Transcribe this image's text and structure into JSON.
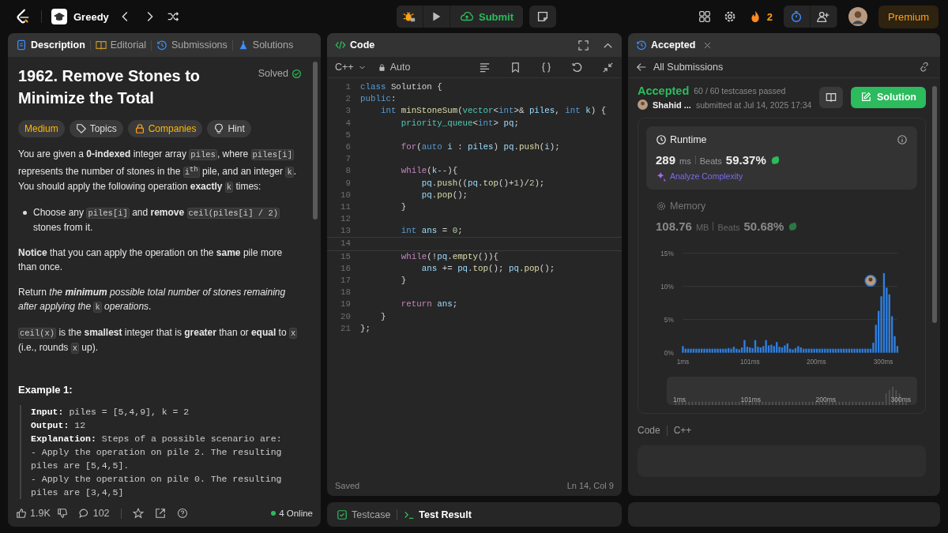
{
  "topbar": {
    "list_name": "Greedy",
    "submit": "Submit",
    "streak": "2",
    "premium": "Premium"
  },
  "left_panel": {
    "tabs": [
      {
        "label": "Description",
        "kind": "description",
        "selected": true
      },
      {
        "label": "Editorial",
        "kind": "editorial",
        "selected": false
      },
      {
        "label": "Submissions",
        "kind": "submissions",
        "selected": false
      },
      {
        "label": "Solutions",
        "kind": "solutions",
        "selected": false
      }
    ],
    "title": "1962. Remove Stones to Minimize the Total",
    "status": "Solved",
    "solved": true,
    "tags": [
      {
        "label": "Medium",
        "kind": "difficulty"
      },
      {
        "label": "Topics",
        "kind": "topics"
      },
      {
        "label": "Companies",
        "kind": "companies"
      },
      {
        "label": "Hint",
        "kind": "hint"
      }
    ],
    "paragraphs": [
      {
        "kind": "text",
        "segments": [
          {
            "kind": "text",
            "t": "You are given a **0-indexed** integer array "
          },
          {
            "kind": "code",
            "t": "piles"
          },
          {
            "kind": "text",
            "t": ", where "
          },
          {
            "kind": "code",
            "t": "piles[i]"
          },
          {
            "kind": "text",
            "t": " represents the number of stones in the "
          },
          {
            "kind": "code",
            "t": "i$^{th}$"
          },
          {
            "kind": "text",
            "t": " pile, and an integer "
          },
          {
            "kind": "code",
            "t": "k"
          },
          {
            "kind": "text",
            "t": ". You should apply the following operation **exactly** "
          },
          {
            "kind": "code",
            "t": "k"
          },
          {
            "kind": "text",
            "t": " times:"
          }
        ]
      },
      {
        "kind": "bullet",
        "segments": [
          {
            "kind": "text",
            "t": "Choose any "
          },
          {
            "kind": "code",
            "t": "piles[i]"
          },
          {
            "kind": "text",
            "t": " and **remove** "
          },
          {
            "kind": "code",
            "t": "ceil(piles[i] / 2)"
          },
          {
            "kind": "text",
            "t": " stones from it."
          }
        ]
      },
      {
        "kind": "text",
        "segments": [
          {
            "kind": "text",
            "t": "**Notice** that you can apply the operation on the **same** pile more than once."
          }
        ]
      },
      {
        "kind": "text",
        "segments": [
          {
            "kind": "text",
            "t": "Return "
          },
          {
            "kind": "em",
            "t": "the **minimum** possible total number of stones remaining after applying the "
          },
          {
            "kind": "code",
            "t": "k"
          },
          {
            "kind": "em",
            "t": " operations"
          },
          {
            "kind": "text",
            "t": "."
          }
        ]
      },
      {
        "kind": "text",
        "segments": [
          {
            "kind": "code",
            "t": "ceil(x)"
          },
          {
            "kind": "text",
            "t": " is the **smallest** integer that is **greater** than or **equal** to "
          },
          {
            "kind": "code",
            "t": "x"
          },
          {
            "kind": "text",
            "t": " (i.e., rounds "
          },
          {
            "kind": "code",
            "t": "x"
          },
          {
            "kind": "text",
            "t": " up)."
          }
        ]
      }
    ],
    "example_title": "Example 1:",
    "example_lines": [
      {
        "label": "Input:",
        "text": "piles = [5,4,9], k = 2"
      },
      {
        "label": "Output:",
        "text": "12"
      },
      {
        "label": "Explanation:",
        "text": "Steps of a possible scenario are:"
      },
      {
        "text": "- Apply the operation on pile 2. The resulting piles are [5,4,5]."
      },
      {
        "text": "- Apply the operation on pile 0. The resulting piles are [3,4,5]"
      }
    ],
    "footer": {
      "likes": "1.9K",
      "comments": "102",
      "online": "4 Online"
    }
  },
  "code_panel": {
    "title": "Code",
    "language": "C++",
    "mode": "Auto",
    "saved": "Saved",
    "cursor": "Ln 14, Col 9",
    "lines": [
      {
        "n": "1",
        "tokens": [
          {
            "kind": "kw",
            "t": "class"
          },
          {
            "kind": "p",
            "t": " Solution {"
          }
        ]
      },
      {
        "n": "2",
        "tokens": [
          {
            "kind": "kw",
            "t": "public"
          },
          {
            "kind": "p",
            "t": ":"
          }
        ]
      },
      {
        "n": "3",
        "tokens": [
          {
            "kind": "kw",
            "t": "    int"
          },
          {
            "kind": "fn",
            "t": " minStoneSum"
          },
          {
            "kind": "p",
            "t": "("
          },
          {
            "kind": "ty",
            "t": "vector"
          },
          {
            "kind": "p",
            "t": "<"
          },
          {
            "kind": "kw",
            "t": "int"
          },
          {
            "kind": "p",
            "t": ">& "
          },
          {
            "kind": "v",
            "t": "piles"
          },
          {
            "kind": "p",
            "t": ", "
          },
          {
            "kind": "kw",
            "t": "int"
          },
          {
            "kind": "v",
            "t": " k"
          },
          {
            "kind": "p",
            "t": ") {"
          }
        ]
      },
      {
        "n": "4",
        "tokens": [
          {
            "kind": "ty",
            "t": "        priority_queue"
          },
          {
            "kind": "p",
            "t": "<"
          },
          {
            "kind": "kw",
            "t": "int"
          },
          {
            "kind": "p",
            "t": "> "
          },
          {
            "kind": "v",
            "t": "pq"
          },
          {
            "kind": "p",
            "t": ";"
          }
        ]
      },
      {
        "n": "5"
      },
      {
        "n": "6",
        "tokens": [
          {
            "kind": "ctl",
            "t": "        for"
          },
          {
            "kind": "p",
            "t": "("
          },
          {
            "kind": "kw",
            "t": "auto"
          },
          {
            "kind": "v",
            "t": " i"
          },
          {
            "kind": "p",
            "t": " : "
          },
          {
            "kind": "v",
            "t": "piles"
          },
          {
            "kind": "p",
            "t": ") "
          },
          {
            "kind": "v",
            "t": "pq"
          },
          {
            "kind": "p",
            "t": "."
          },
          {
            "kind": "fn",
            "t": "push"
          },
          {
            "kind": "p",
            "t": "("
          },
          {
            "kind": "v",
            "t": "i"
          },
          {
            "kind": "p",
            "t": ");"
          }
        ]
      },
      {
        "n": "7"
      },
      {
        "n": "8",
        "tokens": [
          {
            "kind": "ctl",
            "t": "        while"
          },
          {
            "kind": "p",
            "t": "("
          },
          {
            "kind": "v",
            "t": "k"
          },
          {
            "kind": "p",
            "t": "--){"
          }
        ]
      },
      {
        "n": "9",
        "tokens": [
          {
            "kind": "v",
            "t": "            pq"
          },
          {
            "kind": "p",
            "t": "."
          },
          {
            "kind": "fn",
            "t": "push"
          },
          {
            "kind": "p",
            "t": "(("
          },
          {
            "kind": "v",
            "t": "pq"
          },
          {
            "kind": "p",
            "t": "."
          },
          {
            "kind": "fn",
            "t": "top"
          },
          {
            "kind": "p",
            "t": "()+"
          },
          {
            "kind": "num",
            "t": "1"
          },
          {
            "kind": "p",
            "t": ")/"
          },
          {
            "kind": "num",
            "t": "2"
          },
          {
            "kind": "p",
            "t": ");"
          }
        ]
      },
      {
        "n": "10",
        "tokens": [
          {
            "kind": "v",
            "t": "            pq"
          },
          {
            "kind": "p",
            "t": "."
          },
          {
            "kind": "fn",
            "t": "pop"
          },
          {
            "kind": "p",
            "t": "();"
          }
        ]
      },
      {
        "n": "11",
        "tokens": [
          {
            "kind": "p",
            "t": "        }"
          }
        ]
      },
      {
        "n": "12"
      },
      {
        "n": "13",
        "tokens": [
          {
            "kind": "kw",
            "t": "        int"
          },
          {
            "kind": "v",
            "t": " ans"
          },
          {
            "kind": "p",
            "t": " = "
          },
          {
            "kind": "num",
            "t": "0"
          },
          {
            "kind": "p",
            "t": ";"
          }
        ]
      },
      {
        "n": "14",
        "current": true
      },
      {
        "n": "15",
        "tokens": [
          {
            "kind": "ctl",
            "t": "        while"
          },
          {
            "kind": "p",
            "t": "(!"
          },
          {
            "kind": "v",
            "t": "pq"
          },
          {
            "kind": "p",
            "t": "."
          },
          {
            "kind": "fn",
            "t": "empty"
          },
          {
            "kind": "p",
            "t": "()){"
          }
        ]
      },
      {
        "n": "16",
        "tokens": [
          {
            "kind": "v",
            "t": "            ans"
          },
          {
            "kind": "p",
            "t": " += "
          },
          {
            "kind": "v",
            "t": "pq"
          },
          {
            "kind": "p",
            "t": "."
          },
          {
            "kind": "fn",
            "t": "top"
          },
          {
            "kind": "p",
            "t": "(); "
          },
          {
            "kind": "v",
            "t": "pq"
          },
          {
            "kind": "p",
            "t": "."
          },
          {
            "kind": "fn",
            "t": "pop"
          },
          {
            "kind": "p",
            "t": "();"
          }
        ]
      },
      {
        "n": "17",
        "tokens": [
          {
            "kind": "p",
            "t": "        }"
          }
        ]
      },
      {
        "n": "18"
      },
      {
        "n": "19",
        "tokens": [
          {
            "kind": "ctl",
            "t": "        return"
          },
          {
            "kind": "v",
            "t": " ans"
          },
          {
            "kind": "p",
            "t": ";"
          }
        ]
      },
      {
        "n": "20",
        "tokens": [
          {
            "kind": "p",
            "t": "    }"
          }
        ]
      },
      {
        "n": "21",
        "tokens": [
          {
            "kind": "p",
            "t": "};"
          }
        ]
      }
    ]
  },
  "bottom_tabs": [
    {
      "label": "Testcase",
      "kind": "testcase",
      "selected": false
    },
    {
      "label": "Test Result",
      "kind": "result",
      "selected": true
    }
  ],
  "result_panel": {
    "tab": "Accepted",
    "back": "All Submissions",
    "status": "Accepted",
    "passed": "60 / 60 testcases passed",
    "user": "Shahid ...",
    "submitted": "submitted at Jul 14, 2025 17:34",
    "solution_button": "Solution",
    "metrics": [
      {
        "kind": "runtime",
        "title": "Runtime",
        "value": "289",
        "unit": "ms",
        "beats": "Beats",
        "percent": "59.37%",
        "selected": true,
        "action": "Analyze Complexity"
      },
      {
        "kind": "memory",
        "title": "Memory",
        "value": "108.76",
        "unit": "MB",
        "beats": "Beats",
        "percent": "50.68%",
        "selected": false
      }
    ],
    "chart_data": {
      "type": "bar",
      "xlim": [
        1,
        321
      ],
      "ylim": [
        0,
        15
      ],
      "xticks": [
        {
          "value": 1,
          "label": "1ms"
        },
        {
          "value": 101,
          "label": "101ms"
        },
        {
          "value": 200,
          "label": "200ms"
        },
        {
          "value": 300,
          "label": "300ms"
        }
      ],
      "yticks": [
        {
          "value": 0,
          "label": "0%"
        },
        {
          "value": 5,
          "label": "5%"
        },
        {
          "value": 10,
          "label": "10%"
        },
        {
          "value": 15,
          "label": "15%"
        }
      ],
      "x": [
        1,
        5,
        9,
        13,
        17,
        21,
        25,
        29,
        33,
        37,
        41,
        45,
        49,
        53,
        57,
        61,
        65,
        69,
        73,
        77,
        81,
        85,
        89,
        93,
        97,
        101,
        105,
        109,
        113,
        117,
        121,
        125,
        129,
        133,
        137,
        141,
        145,
        149,
        153,
        157,
        161,
        165,
        169,
        173,
        177,
        181,
        185,
        189,
        193,
        197,
        201,
        205,
        209,
        213,
        217,
        221,
        225,
        229,
        233,
        237,
        241,
        245,
        249,
        253,
        257,
        261,
        265,
        269,
        273,
        277,
        281,
        285,
        289,
        293,
        297,
        301,
        305,
        309,
        313,
        317,
        321
      ],
      "series": [
        {
          "color": "#2f7fe0",
          "values": [
            1.0,
            0.6,
            0.6,
            0.6,
            0.6,
            0.6,
            0.6,
            0.6,
            0.6,
            0.6,
            0.6,
            0.6,
            0.6,
            0.6,
            0.6,
            0.6,
            0.6,
            0.7,
            0.6,
            0.9,
            0.6,
            0.5,
            0.8,
            1.9,
            0.9,
            0.8,
            0.7,
            1.9,
            0.9,
            0.8,
            1.0,
            1.9,
            1.1,
            1.2,
            1.0,
            1.6,
            0.9,
            0.8,
            1.1,
            1.4,
            0.6,
            0.5,
            0.7,
            1.0,
            0.8,
            0.6,
            0.6,
            0.6,
            0.6,
            0.6,
            0.6,
            0.6,
            0.6,
            0.6,
            0.6,
            0.6,
            0.6,
            0.6,
            0.6,
            0.6,
            0.6,
            0.6,
            0.6,
            0.6,
            0.6,
            0.6,
            0.6,
            0.6,
            0.6,
            0.6,
            0.6,
            1.5,
            4.2,
            6.3,
            8.5,
            12.0,
            9.8,
            8.8,
            5.5,
            2.5,
            1.0
          ]
        }
      ]
    },
    "brush_labels": [
      "1ms",
      "101ms",
      "200ms",
      "300ms"
    ],
    "code_label": "Code",
    "code_language": "C++"
  }
}
